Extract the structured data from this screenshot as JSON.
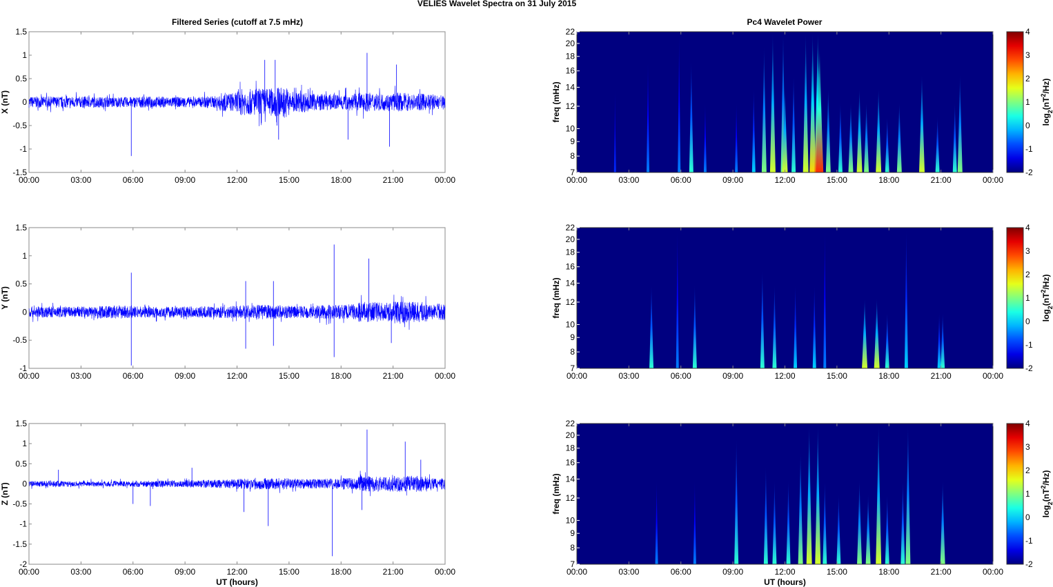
{
  "chart_data": {
    "type": "line+heatmap",
    "title": "VELIES Wavelet Spectra on 31 July     2015",
    "left_title": "Filtered Series (cutoff at 7.5 mHz)",
    "right_title": "Pc4 Wavelet Power",
    "xlabel": "UT (hours)",
    "xticks": [
      "00:00",
      "03:00",
      "06:00",
      "09:00",
      "12:00",
      "15:00",
      "18:00",
      "21:00",
      "00:00"
    ],
    "xlim": [
      0,
      24
    ],
    "freq_label": "freq (mHz)",
    "freq_ticks": [
      7,
      8,
      9,
      10,
      12,
      14,
      16,
      18,
      20,
      22
    ],
    "freq_lim": [
      7,
      22
    ],
    "colorbar_label": "log2(nT2/Hz)",
    "colorbar_ticks": [
      -2,
      -1,
      0,
      1,
      2,
      3,
      4
    ],
    "clim": [
      -2,
      4
    ],
    "series_color": "#0000ff",
    "panels": [
      {
        "name": "X",
        "ylabel": "X (nT)",
        "ylim": [
          -1.5,
          1.5
        ],
        "yticks": [
          "-1.5",
          "-1",
          "-0.5",
          "0",
          "0.5",
          "1",
          "1.5"
        ],
        "envelope": [
          0.12,
          0.12,
          0.12,
          0.12,
          0.11,
          0.11,
          0.12,
          0.12,
          0.11,
          0.11,
          0.13,
          0.2,
          0.28,
          0.3,
          0.32,
          0.22,
          0.18,
          0.17,
          0.18,
          0.2,
          0.18,
          0.2,
          0.18,
          0.16
        ],
        "spikes": [
          [
            5.9,
            -1.15
          ],
          [
            13.6,
            0.9
          ],
          [
            14.2,
            0.9
          ],
          [
            14.3,
            -0.5
          ],
          [
            14.4,
            -0.8
          ],
          [
            18.4,
            -0.8
          ],
          [
            19.5,
            1.05
          ],
          [
            20.8,
            -0.95
          ],
          [
            21.2,
            0.8
          ]
        ],
        "wavelet_events": [
          [
            2.2,
            -1,
            0.6
          ],
          [
            4.1,
            -0.5,
            0.8
          ],
          [
            5.9,
            -0.5,
            1
          ],
          [
            6.6,
            0.5,
            0.8
          ],
          [
            7.4,
            -0.5,
            0.5
          ],
          [
            9.2,
            -0.5,
            0.5
          ],
          [
            10.2,
            0,
            0.6
          ],
          [
            10.8,
            1,
            0.9
          ],
          [
            11.3,
            1.5,
            1
          ],
          [
            11.9,
            1,
            1
          ],
          [
            12.0,
            1.5,
            0.6
          ],
          [
            12.5,
            0.5,
            0.7
          ],
          [
            13.2,
            1.5,
            1
          ],
          [
            13.6,
            2,
            1
          ],
          [
            13.9,
            2.5,
            1
          ],
          [
            14.0,
            3,
            0.9
          ],
          [
            14.5,
            1,
            0.6
          ],
          [
            15.2,
            0.5,
            0.5
          ],
          [
            15.8,
            1,
            0.5
          ],
          [
            16.3,
            1.5,
            0.6
          ],
          [
            16.7,
            1,
            0.5
          ],
          [
            17.4,
            1.5,
            0.6
          ],
          [
            17.9,
            0.5,
            0.4
          ],
          [
            18.6,
            1,
            0.5
          ],
          [
            19.9,
            1.5,
            0.7
          ],
          [
            20.8,
            0.5,
            0.4
          ],
          [
            21.8,
            0.5,
            0.5
          ],
          [
            22.1,
            1,
            0.7
          ]
        ]
      },
      {
        "name": "Y",
        "ylabel": "Y (nT)",
        "ylim": [
          -1,
          1.5
        ],
        "yticks": [
          "-1",
          "-0.5",
          "0",
          "0.5",
          "1",
          "1.5"
        ],
        "envelope": [
          0.1,
          0.1,
          0.1,
          0.1,
          0.12,
          0.12,
          0.1,
          0.1,
          0.1,
          0.1,
          0.1,
          0.11,
          0.12,
          0.13,
          0.12,
          0.11,
          0.12,
          0.13,
          0.14,
          0.18,
          0.17,
          0.2,
          0.18,
          0.14
        ],
        "spikes": [
          [
            5.9,
            0.7
          ],
          [
            5.9,
            -0.95
          ],
          [
            12.5,
            0.55
          ],
          [
            12.5,
            -0.65
          ],
          [
            14.1,
            0.55
          ],
          [
            14.1,
            -0.6
          ],
          [
            17.6,
            1.2
          ],
          [
            17.6,
            -0.8
          ],
          [
            19.6,
            0.95
          ],
          [
            20.9,
            -0.55
          ]
        ],
        "wavelet_events": [
          [
            4.3,
            0.5,
            0.6
          ],
          [
            5.8,
            -0.5,
            1
          ],
          [
            6.8,
            0.5,
            0.6
          ],
          [
            10.7,
            0.5,
            0.7
          ],
          [
            11.4,
            0.5,
            0.6
          ],
          [
            12.6,
            0,
            0.6
          ],
          [
            13.7,
            0,
            0.6
          ],
          [
            14.3,
            -0.5,
            1
          ],
          [
            16.6,
            1.5,
            0.5
          ],
          [
            17.3,
            1.5,
            0.5
          ],
          [
            17.9,
            0.5,
            0.4
          ],
          [
            19.0,
            0,
            1
          ],
          [
            20.9,
            0,
            0.4
          ],
          [
            21.1,
            0.5,
            0.4
          ]
        ]
      },
      {
        "name": "Z",
        "ylabel": "Z (nT)",
        "ylim": [
          -2,
          1.5
        ],
        "yticks": [
          "-2",
          "-1.5",
          "-1",
          "-0.5",
          "0",
          "0.5",
          "1",
          "1.5"
        ],
        "envelope": [
          0.07,
          0.08,
          0.07,
          0.07,
          0.07,
          0.07,
          0.08,
          0.08,
          0.08,
          0.09,
          0.1,
          0.11,
          0.13,
          0.14,
          0.14,
          0.12,
          0.12,
          0.13,
          0.15,
          0.2,
          0.18,
          0.2,
          0.2,
          0.14
        ],
        "spikes": [
          [
            1.7,
            0.35
          ],
          [
            6.0,
            -0.5
          ],
          [
            7.0,
            -0.55
          ],
          [
            9.4,
            0.4
          ],
          [
            12.4,
            -0.7
          ],
          [
            13.8,
            -1.05
          ],
          [
            17.5,
            -1.8
          ],
          [
            19.2,
            -0.65
          ],
          [
            19.5,
            1.35
          ],
          [
            21.7,
            1.05
          ],
          [
            22.6,
            0.6
          ]
        ],
        "wavelet_events": [
          [
            4.6,
            -0.5,
            0.6
          ],
          [
            6.8,
            -0.5,
            0.6
          ],
          [
            9.2,
            0.5,
            0.9
          ],
          [
            10.9,
            0.5,
            0.7
          ],
          [
            11.4,
            0.5,
            0.6
          ],
          [
            12.2,
            0.5,
            0.6
          ],
          [
            12.9,
            1,
            0.8
          ],
          [
            13.4,
            1.5,
            1
          ],
          [
            13.9,
            1.5,
            1
          ],
          [
            14.3,
            0.5,
            0.6
          ],
          [
            15.1,
            0.5,
            0.5
          ],
          [
            16.3,
            1,
            0.6
          ],
          [
            16.8,
            1,
            0.5
          ],
          [
            17.4,
            1.5,
            1
          ],
          [
            17.9,
            0.5,
            0.5
          ],
          [
            18.8,
            0.5,
            0.6
          ],
          [
            19.1,
            1,
            1
          ],
          [
            21.1,
            1,
            0.6
          ]
        ]
      }
    ]
  }
}
